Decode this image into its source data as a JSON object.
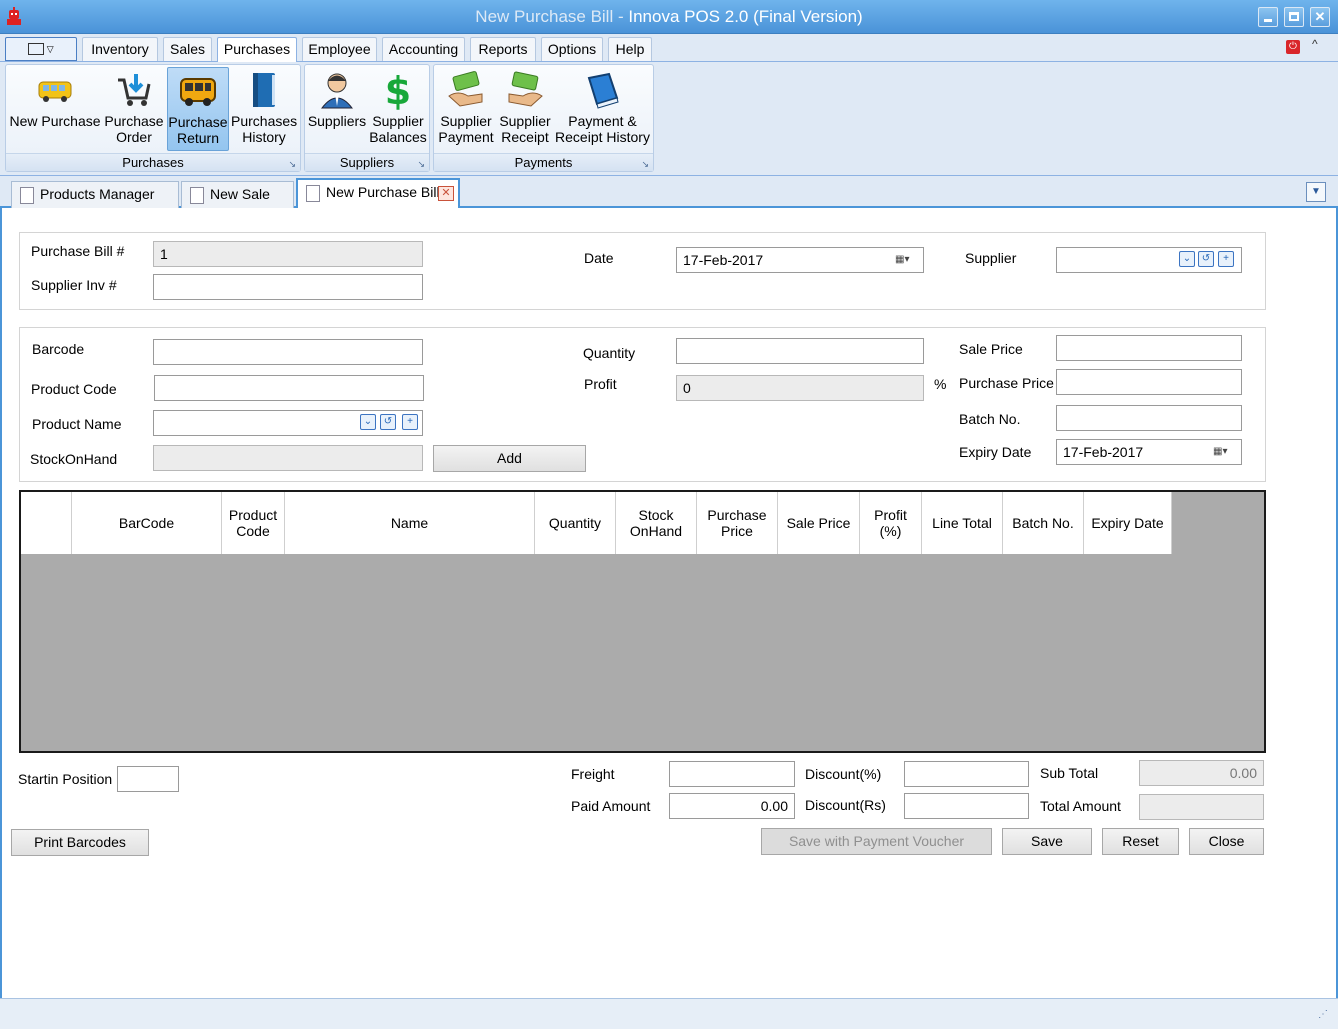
{
  "window": {
    "title_dim": "New Purchase Bill - ",
    "title_main": "Innova POS 2.0  (Final Version)",
    "accent": "#4b95d8"
  },
  "menu": {
    "tabs": [
      "Inventory",
      "Sales",
      "Purchases",
      "Employee",
      "Accounting",
      "Reports",
      "Options",
      "Help"
    ],
    "active": "Purchases"
  },
  "ribbon": {
    "purchases": {
      "label": "Purchases",
      "buttons": [
        {
          "l1": "New Purchase",
          "l2": ""
        },
        {
          "l1": "Purchase",
          "l2": "Order"
        },
        {
          "l1": "Purchase",
          "l2": "Return"
        },
        {
          "l1": "Purchases",
          "l2": "History"
        }
      ]
    },
    "suppliers": {
      "label": "Suppliers",
      "buttons": [
        {
          "l1": "Suppliers",
          "l2": ""
        },
        {
          "l1": "Supplier",
          "l2": "Balances"
        }
      ]
    },
    "payments": {
      "label": "Payments",
      "buttons": [
        {
          "l1": "Supplier",
          "l2": "Payment"
        },
        {
          "l1": "Supplier",
          "l2": "Receipt"
        },
        {
          "l1": "Payment &",
          "l2": "Receipt History"
        }
      ]
    }
  },
  "doctabs": [
    "Products Manager",
    "New Sale",
    "New Purchase Bill"
  ],
  "header": {
    "bill_label": "Purchase Bill #",
    "bill_value": "1",
    "inv_label": "Supplier Inv #",
    "inv_value": "",
    "date_label": "Date",
    "date_value": "17-Feb-2017",
    "supplier_label": "Supplier",
    "supplier_value": ""
  },
  "item": {
    "barcode_label": "Barcode",
    "code_label": "Product Code",
    "name_label": "Product Name",
    "stock_label": "StockOnHand",
    "add_label": "Add",
    "qty_label": "Quantity",
    "profit_label": "Profit",
    "profit_value": "0",
    "pct": "%",
    "sale_label": "Sale Price",
    "purchase_label": "Purchase Price",
    "batch_label": "Batch No.",
    "expiry_label": "Expiry Date",
    "expiry_value": "17-Feb-2017"
  },
  "grid": {
    "columns": [
      {
        "l1": "",
        "l2": ""
      },
      {
        "l1": "BarCode",
        "l2": ""
      },
      {
        "l1": "Product",
        "l2": "Code"
      },
      {
        "l1": "Name",
        "l2": ""
      },
      {
        "l1": "Quantity",
        "l2": ""
      },
      {
        "l1": "Stock",
        "l2": "OnHand"
      },
      {
        "l1": "Purchase",
        "l2": "Price"
      },
      {
        "l1": "Sale Price",
        "l2": ""
      },
      {
        "l1": "Profit",
        "l2": "(%)"
      },
      {
        "l1": "Line Total",
        "l2": ""
      },
      {
        "l1": "Batch No.",
        "l2": ""
      },
      {
        "l1": "Expiry Date",
        "l2": ""
      }
    ]
  },
  "footer": {
    "start_label": "Startin Position",
    "start_value": "",
    "freight_label": "Freight",
    "freight_value": "",
    "paid_label": "Paid Amount",
    "paid_value": "0.00",
    "disc_pct_label": "Discount(%)",
    "disc_pct_value": "",
    "disc_rs_label": "Discount(Rs)",
    "disc_rs_value": "",
    "subtotal_label": "Sub Total",
    "subtotal_value": "0.00",
    "total_label": "Total Amount",
    "total_value": "",
    "print_label": "Print Barcodes",
    "save_voucher_label": "Save with Payment Voucher",
    "save_label": "Save",
    "reset_label": "Reset",
    "close_label": "Close"
  }
}
